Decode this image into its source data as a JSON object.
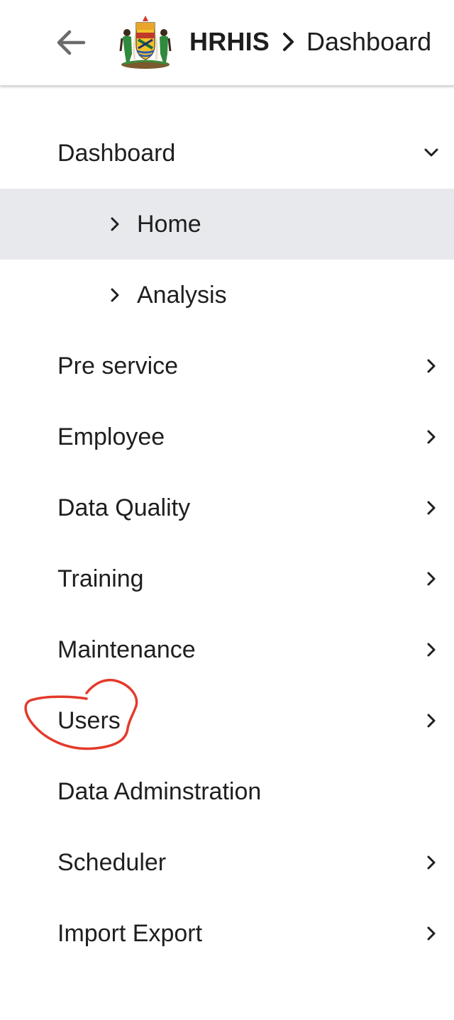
{
  "header": {
    "app_name": "HRHIS",
    "page_name": "Dashboard",
    "back_icon": "arrow-left-icon",
    "separator_icon": "chevron-right-icon"
  },
  "menu": {
    "dashboard": {
      "label": "Dashboard",
      "icon": "chevron-down-icon"
    },
    "home": {
      "label": "Home",
      "icon": "chevron-right-icon"
    },
    "analysis": {
      "label": "Analysis",
      "icon": "chevron-right-icon"
    },
    "pre_service": {
      "label": "Pre service",
      "icon": "chevron-right-icon"
    },
    "employee": {
      "label": "Employee",
      "icon": "chevron-right-icon"
    },
    "data_quality": {
      "label": "Data Quality",
      "icon": "chevron-right-icon"
    },
    "training": {
      "label": "Training",
      "icon": "chevron-right-icon"
    },
    "maintenance": {
      "label": "Maintenance",
      "icon": "chevron-right-icon"
    },
    "users": {
      "label": "Users",
      "icon": "chevron-right-icon"
    },
    "data_administration": {
      "label": "Data Adminstration"
    },
    "scheduler": {
      "label": "Scheduler",
      "icon": "chevron-right-icon"
    },
    "import_export": {
      "label": "Import Export",
      "icon": "chevron-right-icon"
    }
  },
  "colors": {
    "active_background": "#e8e9ec",
    "annotation_stroke": "#e33a2a",
    "text": "#1f1f1f"
  }
}
